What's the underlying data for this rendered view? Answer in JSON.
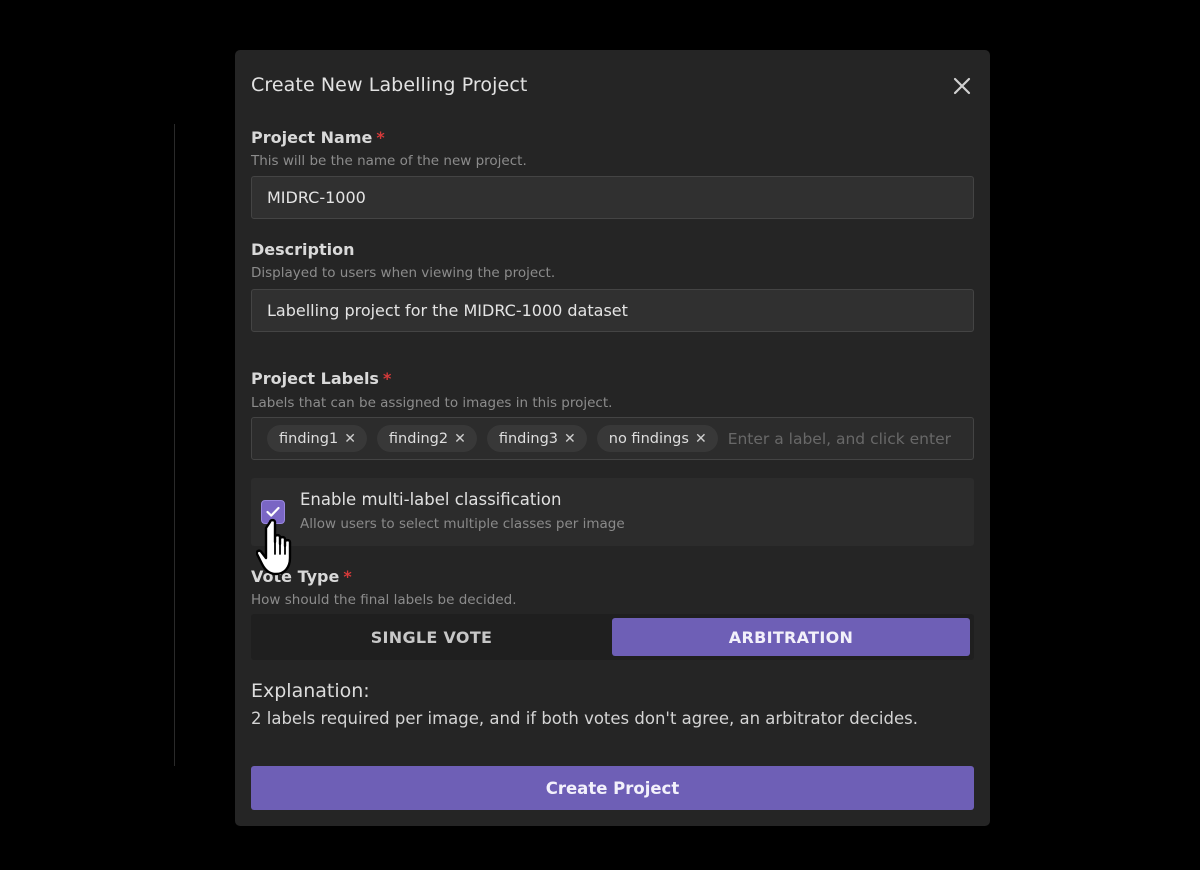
{
  "modal": {
    "title": "Create New Labelling Project",
    "close_icon": "close-icon"
  },
  "project_name": {
    "label": "Project Name",
    "required": "*",
    "hint": "This will be the name of the new project.",
    "value": "MIDRC-1000"
  },
  "description": {
    "label": "Description",
    "hint": "Displayed to users when viewing the project.",
    "value": "Labelling project for the MIDRC-1000 dataset"
  },
  "project_labels": {
    "label": "Project Labels",
    "required": "*",
    "hint": "Labels that can be assigned to images in this project.",
    "tags": [
      "finding1",
      "finding2",
      "finding3",
      "no findings"
    ],
    "remove_glyph": "✕",
    "placeholder": "Enter a label, and click enter"
  },
  "multi_label": {
    "checked": true,
    "label": "Enable multi-label classification",
    "hint": "Allow users to select multiple classes per image"
  },
  "vote_type": {
    "label": "Vote Type",
    "required": "*",
    "hint": "How should the final labels be decided.",
    "options": [
      "SINGLE VOTE",
      "ARBITRATION"
    ],
    "selected": "ARBITRATION"
  },
  "explanation": {
    "title": "Explanation:",
    "text": "2 labels required per image, and if both votes don't agree, an arbitrator decides."
  },
  "actions": {
    "create_label": "Create Project"
  },
  "colors": {
    "accent": "#6e5fb6",
    "modal_bg": "#252525",
    "required": "#d63a3a"
  }
}
